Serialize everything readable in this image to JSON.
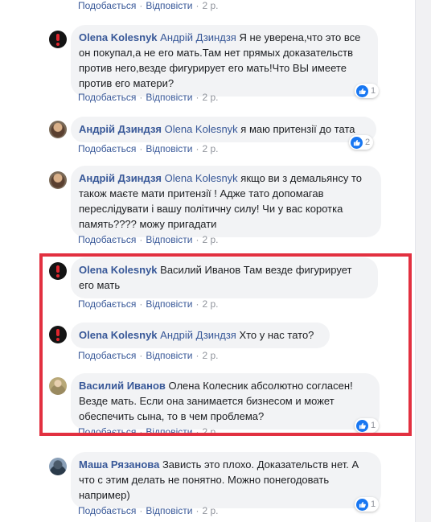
{
  "action_labels": {
    "like": "Подобається",
    "reply": "Відповісти",
    "dot": "·"
  },
  "comments": [
    {
      "author": "",
      "mention": "",
      "text": "",
      "time": "2 р."
    },
    {
      "author": "Olena Kolesnyk",
      "mention": "Андрій Дзиндзя",
      "lines": [
        " Я не уверена,что это все",
        "он покупал,а не его мать.Там нет прямых доказательств",
        "против него,везде фигурирует его мать!Что ВЫ имеете",
        "против его матери?"
      ],
      "time": "2 р.",
      "reactions": "1"
    },
    {
      "author": "Андрій Дзиндзя",
      "mention": "Olena Kolesnyk",
      "lines": [
        " я маю притензії до тата"
      ],
      "time": "2 р.",
      "reactions": "2"
    },
    {
      "author": "Андрій Дзиндзя",
      "mention": "Olena Kolesnyk",
      "lines": [
        " якщо ви з демальянсу то",
        "також маєте мати притензії ! Адже тато допомагав",
        "переслідувати і вашу політичну силу! Чи у вас коротка",
        "память???? можу пригадати"
      ],
      "time": "2 р."
    },
    {
      "author": "Olena Kolesnyk",
      "mention": "",
      "lines": [
        " Василий Иванов Там везде фигурирует",
        "его мать"
      ],
      "time": "2 р."
    },
    {
      "author": "Olena Kolesnyk",
      "mention": "Андрій Дзиндзя",
      "lines": [
        " Хто у нас тато?"
      ],
      "time": "2 р."
    },
    {
      "author": "Василий Иванов",
      "mention": "",
      "lines": [
        " Олена Колесник абсолютно согласен!",
        "Везде мать. Если она занимается бизнесом и может",
        "обеспечить сына, то в чем проблема?"
      ],
      "time": "2 р.",
      "reactions": "1"
    },
    {
      "author": "Маша Рязанова",
      "mention": "",
      "lines": [
        " Зависть это плохо. Доказательств нет. А",
        "что с этим делать не понятно. Можно понегодовать",
        "например)"
      ],
      "time": "2 р.",
      "reactions": "1"
    }
  ],
  "colors": {
    "link": "#385898",
    "bubble": "#f2f3f5",
    "like": "#1877f2",
    "highlight": "#e23040"
  }
}
